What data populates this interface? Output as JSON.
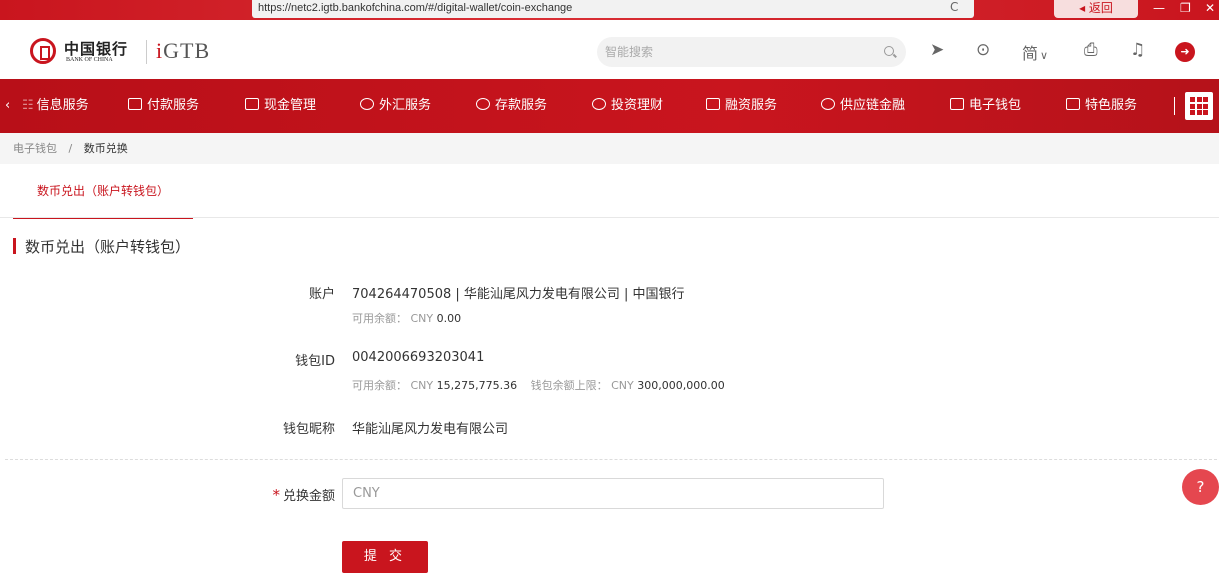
{
  "browser": {
    "url": "https://netc2.igtb.bankofchina.com/#/digital-wallet/coin-exchange",
    "back_label": "返回"
  },
  "header": {
    "logo_cn": "中国银行",
    "logo_en": "BANK OF CHINA",
    "product_logo": "GTB",
    "search_placeholder": "智能搜索",
    "language": "简",
    "icons": [
      "send-icon",
      "location-icon",
      "language-icon",
      "print-icon",
      "bell-icon",
      "logout-icon"
    ]
  },
  "nav": {
    "items": [
      {
        "label": "信息服务"
      },
      {
        "label": "付款服务"
      },
      {
        "label": "现金管理"
      },
      {
        "label": "外汇服务"
      },
      {
        "label": "存款服务"
      },
      {
        "label": "投资理财"
      },
      {
        "label": "融资服务"
      },
      {
        "label": "供应链金融"
      },
      {
        "label": "电子钱包"
      },
      {
        "label": "特色服务"
      }
    ]
  },
  "breadcrumb": {
    "parent": "电子钱包",
    "separator": "/",
    "current": "数币兑换"
  },
  "tabs": [
    {
      "label": "数币兑出（账户转钱包）"
    }
  ],
  "section": {
    "title": "数币兑出（账户转钱包）"
  },
  "form": {
    "account": {
      "label": "账户",
      "value": "704264470508 | 华能汕尾风力发电有限公司 | 中国银行",
      "balance_label": "可用余额：",
      "balance_currency": "CNY",
      "balance_value": "0.00"
    },
    "wallet_id": {
      "label": "钱包ID",
      "value": "0042006693203041",
      "balance_label": "可用余额：",
      "balance_currency": "CNY",
      "balance_value": "15,275,775.36",
      "limit_label": "钱包余额上限：",
      "limit_currency": "CNY",
      "limit_value": "300,000,000.00"
    },
    "wallet_name": {
      "label": "钱包昵称",
      "value": "华能汕尾风力发电有限公司"
    },
    "amount": {
      "required_mark": "*",
      "label": "兑换金额",
      "placeholder": "CNY"
    },
    "submit_label": "提 交"
  },
  "help_label": "?",
  "colors": {
    "brand": "#c9151e"
  }
}
